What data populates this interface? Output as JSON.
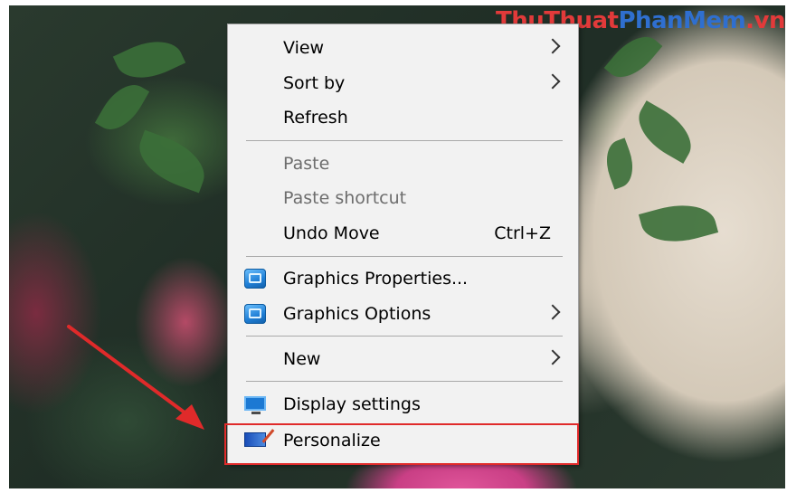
{
  "watermark": {
    "part_a": "ThuThuat",
    "part_b": "PhanMem",
    "part_c": ".vn"
  },
  "menu": {
    "view": "View",
    "sort_by": "Sort by",
    "refresh": "Refresh",
    "paste": "Paste",
    "paste_shortcut": "Paste shortcut",
    "undo_move": "Undo Move",
    "undo_shortcut": "Ctrl+Z",
    "graphics_properties": "Graphics Properties...",
    "graphics_options": "Graphics Options",
    "new": "New",
    "display_settings": "Display settings",
    "personalize": "Personalize"
  },
  "colors": {
    "menu_background": "#f2f2f2",
    "highlight_border": "#e02a2a",
    "arrow": "#e02a2a",
    "disabled_text": "#6d6d6d"
  }
}
